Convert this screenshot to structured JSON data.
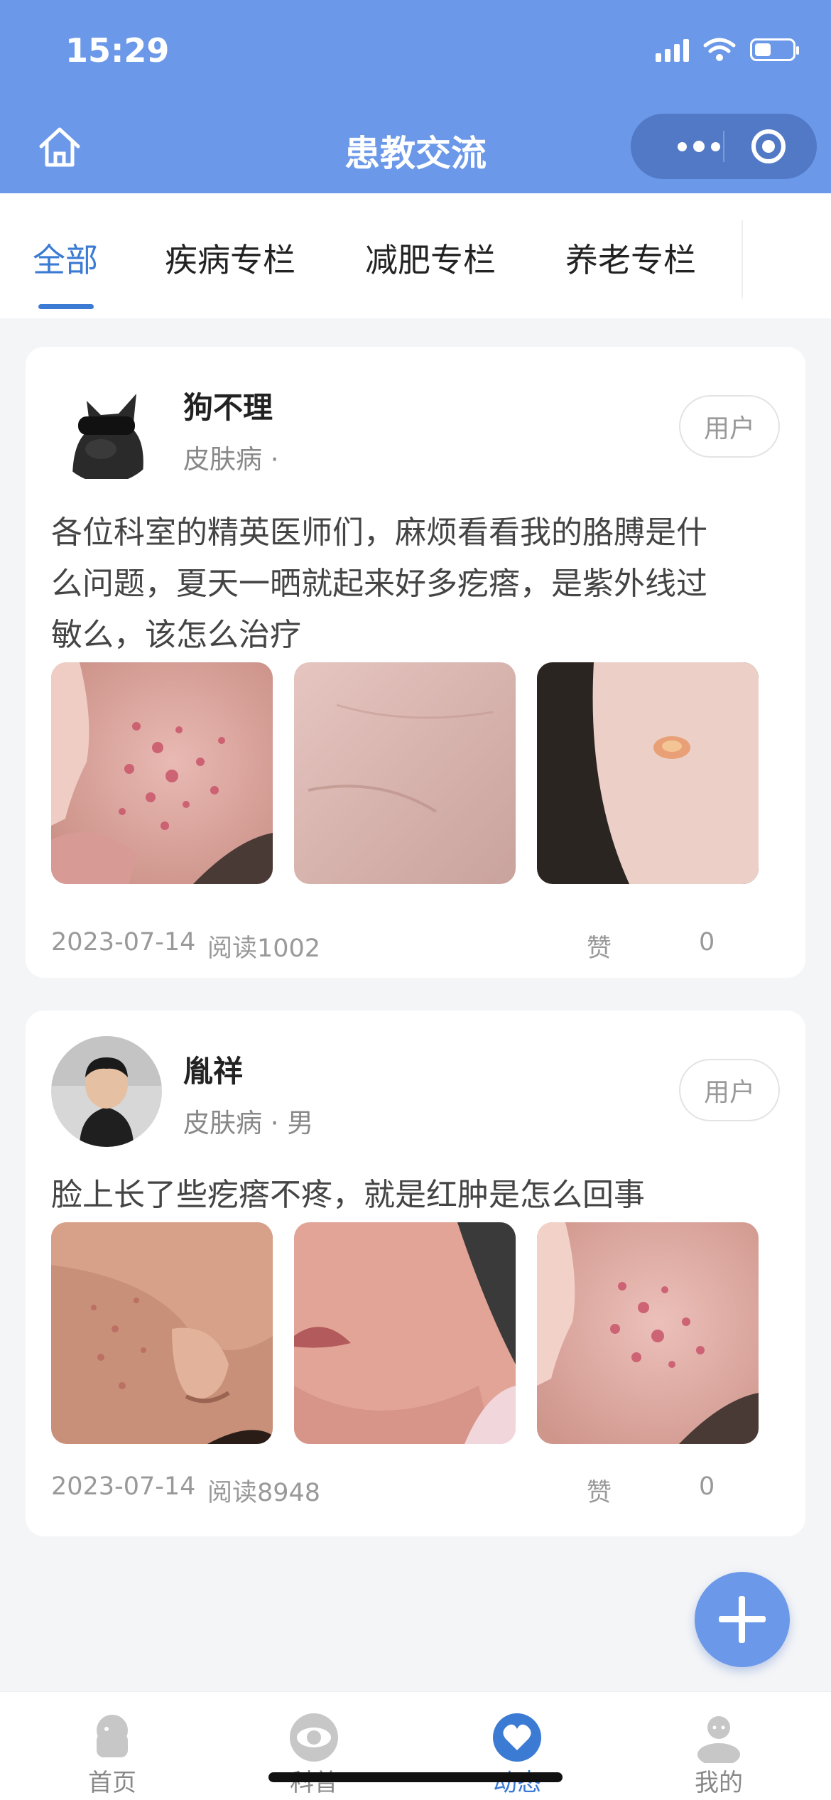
{
  "status_bar": {
    "time": "15:29"
  },
  "nav": {
    "title": "患教交流"
  },
  "tabs": [
    {
      "label": "全部",
      "active": true
    },
    {
      "label": "疾病专栏",
      "active": false
    },
    {
      "label": "减肥专栏",
      "active": false
    },
    {
      "label": "养老专栏",
      "active": false
    }
  ],
  "posts": [
    {
      "username": "狗不理",
      "meta": "皮肤病 ·",
      "role": "用户",
      "text_lines": [
        "各位科室的精英医师们，麻烦看看我的胳膊是什",
        "么问题，夏天一晒就起来好多疙瘩，是紫外线过",
        "敏么，该怎么治疗"
      ],
      "photos": [
        "acne-cheek-photo",
        "skin-closeup-photo",
        "arm-blister-photo"
      ],
      "date": "2023-07-14",
      "reads": "阅读1002",
      "like_label": "赞",
      "like_count": "0"
    },
    {
      "username": "胤祥",
      "meta": "皮肤病 · 男",
      "role": "用户",
      "text_lines": [
        "脸上长了些疙瘩不疼，就是红肿是怎么回事"
      ],
      "photos": [
        "face-bumps-photo",
        "chin-rash-photo",
        "acne-cheek-photo"
      ],
      "date": "2023-07-14",
      "reads": "阅读8948",
      "like_label": "赞",
      "like_count": "0"
    }
  ],
  "bottom_tabs": [
    {
      "label": "首页",
      "icon": "home-icon",
      "active": false
    },
    {
      "label": "科普",
      "icon": "eye-icon",
      "active": false
    },
    {
      "label": "动态",
      "icon": "heart-icon",
      "active": true
    },
    {
      "label": "我的",
      "icon": "person-icon",
      "active": false
    }
  ],
  "colors": {
    "primary": "#6b98e8",
    "active_tab": "#3b7bd4"
  }
}
